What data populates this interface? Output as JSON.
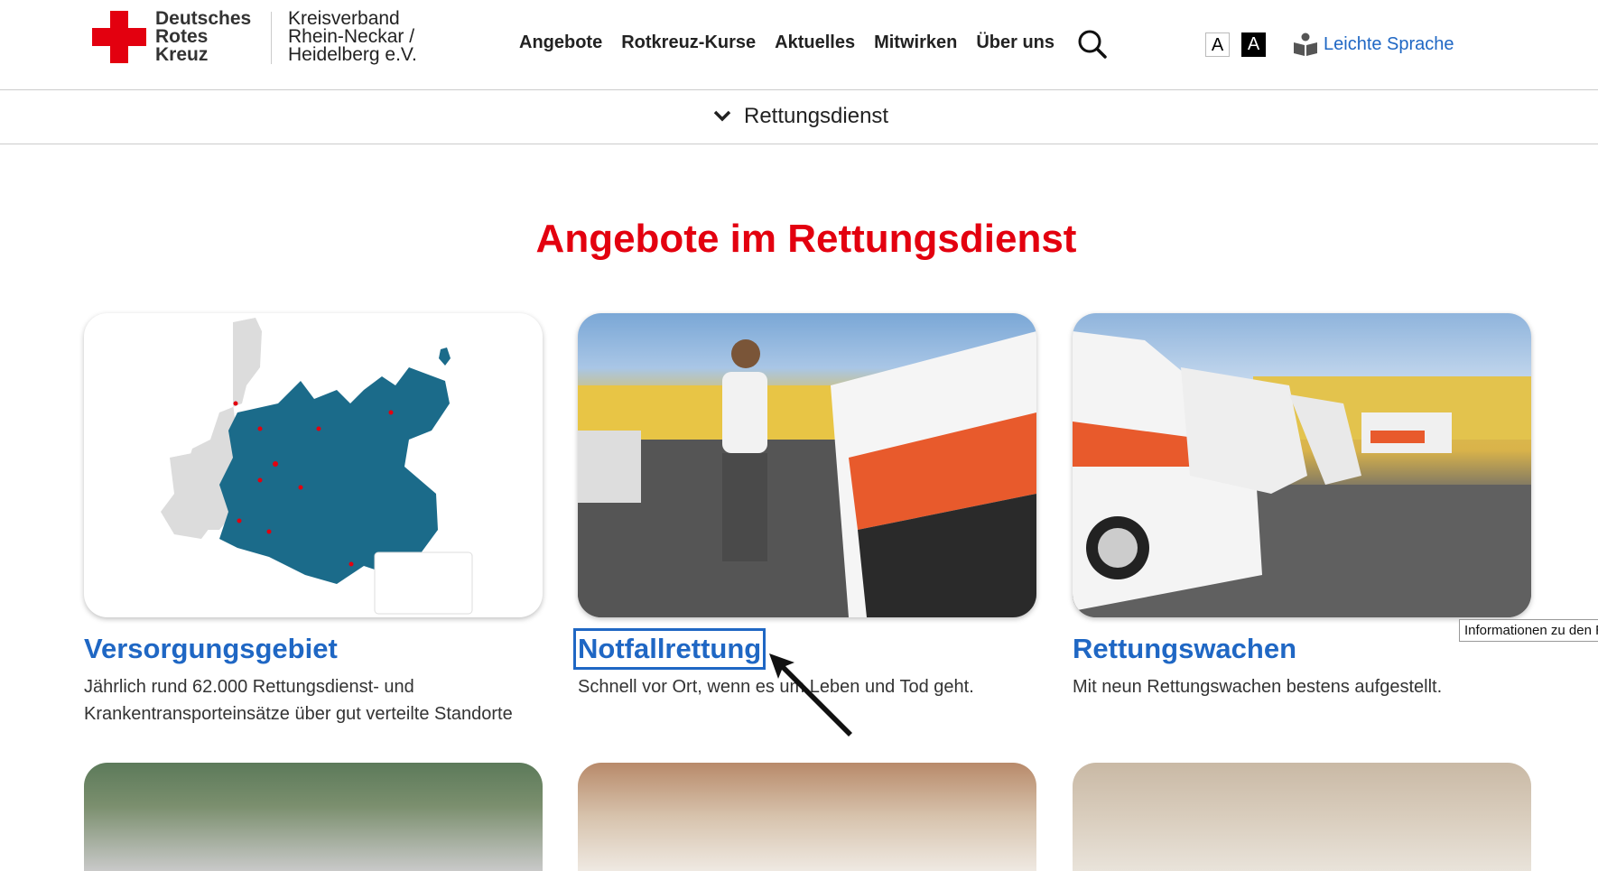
{
  "header": {
    "brand_lines": [
      "Deutsches",
      "Rotes",
      "Kreuz"
    ],
    "org_lines": [
      "Kreisverband",
      "Rhein-Neckar /",
      "Heidelberg e.V."
    ],
    "nav": [
      "Angebote",
      "Rotkreuz-Kurse",
      "Aktuelles",
      "Mitwirken",
      "Über uns"
    ],
    "font_small": "A",
    "font_contrast": "A",
    "easy_language": "Leichte Sprache"
  },
  "subnav": {
    "label": "Rettungsdienst"
  },
  "headline": "Angebote im Rettungsdienst",
  "cards": [
    {
      "title": "Versorgungsgebiet",
      "text": "Jährlich rund 62.000 Rettungsdienst- und Krankentransporteinsätze über gut verteilte Standorte"
    },
    {
      "title": "Notfallrettung",
      "text": "Schnell vor Ort, wenn es um Leben und Tod geht."
    },
    {
      "title": "Rettungswachen",
      "text": "Mit neun Rettungswachen bestens aufgestellt."
    }
  ],
  "tooltip": "Informationen zu den R",
  "colors": {
    "accent_red": "#e3000f",
    "link_blue": "#1f67c4",
    "map_teal": "#1b6b8a"
  }
}
